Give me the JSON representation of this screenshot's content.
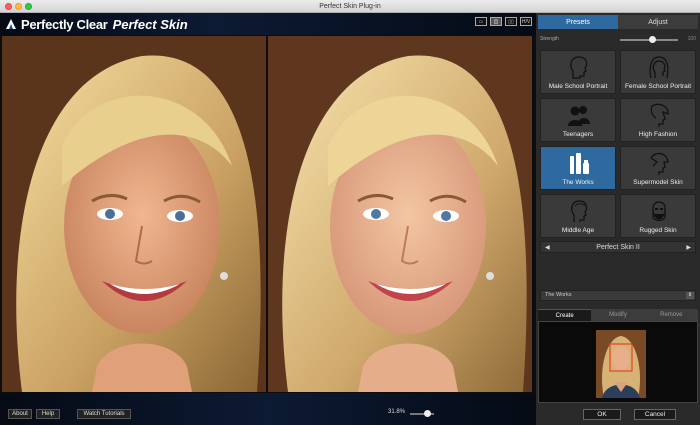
{
  "window": {
    "title": "Perfect Skin Plug-in"
  },
  "header": {
    "brand": "Perfectly Clear",
    "product": "Perfect Skin",
    "view_modes": [
      "▭",
      "◫",
      "▯▯",
      "H/V"
    ]
  },
  "bottom": {
    "about": "About",
    "help": "Help",
    "tutorials": "Watch Tutorials",
    "zoom": "31.8%",
    "zoom_fraction": 0.318
  },
  "panel": {
    "tabs": [
      {
        "label": "Presets",
        "active": true
      },
      {
        "label": "Adjust",
        "active": false
      }
    ],
    "strength": {
      "label": "Strength",
      "value_label": "100",
      "value": 0.55
    },
    "presets": [
      {
        "label": "Male School Portrait",
        "icon": "male-head-icon",
        "active": false
      },
      {
        "label": "Female School Portrait",
        "icon": "female-head-icon",
        "active": false
      },
      {
        "label": "Teenagers",
        "icon": "teen-group-icon",
        "active": false
      },
      {
        "label": "High Fashion",
        "icon": "fashion-head-icon",
        "active": false
      },
      {
        "label": "The Works",
        "icon": "cosmetics-icon",
        "active": true
      },
      {
        "label": "Supermodel Skin",
        "icon": "supermodel-head-icon",
        "active": false
      },
      {
        "label": "Middle Age",
        "icon": "middle-age-head-icon",
        "active": false
      },
      {
        "label": "Rugged Skin",
        "icon": "bearded-head-icon",
        "active": false
      }
    ],
    "skin_selector": {
      "prev": "◀",
      "name": "Perfect Skin II",
      "next": "▶"
    },
    "dropdown": {
      "value": "The Works",
      "arrow": "⇕"
    },
    "actions": [
      {
        "label": "Create",
        "active": true
      },
      {
        "label": "Modify",
        "active": false
      },
      {
        "label": "Remove",
        "active": false
      }
    ]
  },
  "dialog": {
    "ok": "OK",
    "cancel": "Cancel"
  },
  "colors": {
    "accent": "#2e6aa0",
    "panel_bg": "#2a2a2a",
    "face_box": "#e8402a"
  }
}
